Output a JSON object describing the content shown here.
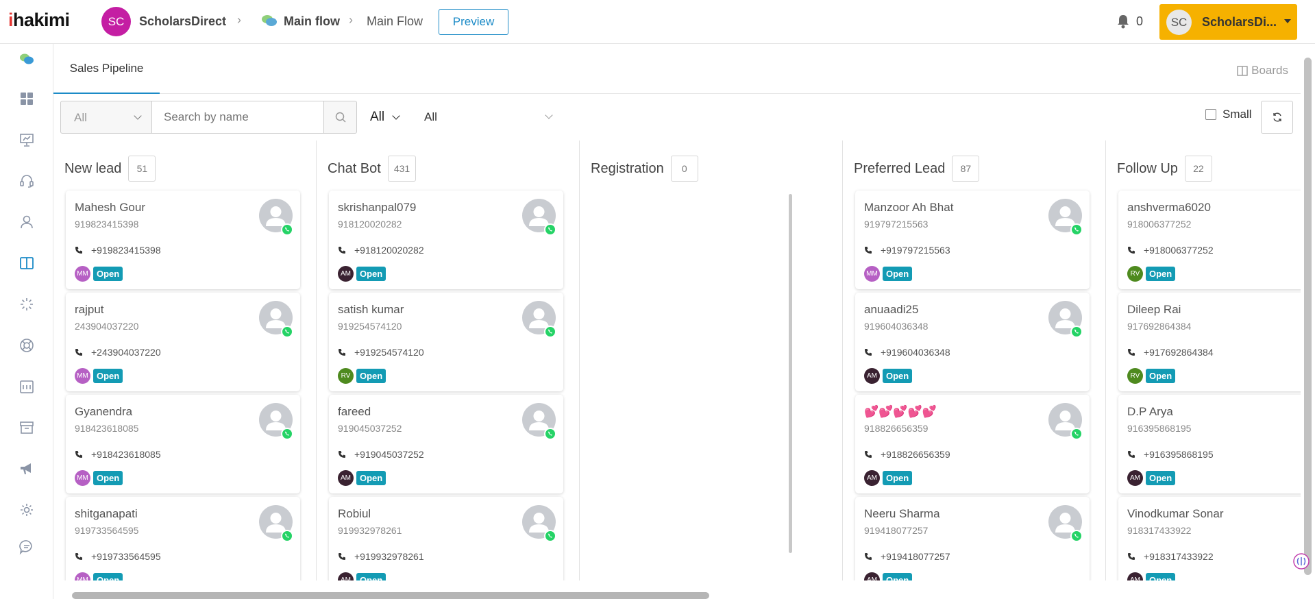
{
  "header": {
    "logo": {
      "dot": "i",
      "rest": "hakimi"
    },
    "workspace": {
      "initials": "SC",
      "name": "ScholarsDirect"
    },
    "breadcrumb": {
      "main": "Main flow",
      "sub": "Main Flow"
    },
    "preview_label": "Preview",
    "notification_count": "0",
    "user": {
      "initials": "SC",
      "name": "ScholarsDi..."
    }
  },
  "tabs": {
    "active": "Sales Pipeline",
    "boards_label": "Boards"
  },
  "filters": {
    "select_all": "All",
    "search_placeholder": "Search by name",
    "dropdown2": "All",
    "dropdown3": "All",
    "small_label": "Small"
  },
  "colors": {
    "accent": "#1c8bc7",
    "user_button": "#f6b100",
    "open_badge": "#139bb4",
    "whatsapp": "#25d366"
  },
  "columns": [
    {
      "title": "New lead",
      "count": "51",
      "cards": [
        {
          "name": "Mahesh Gour",
          "number": "919823415398",
          "phone": "+919823415398",
          "initials": "MM",
          "initials_color": "#b660c4",
          "status": "Open"
        },
        {
          "name": "rajput",
          "number": "243904037220",
          "phone": "+243904037220",
          "initials": "MM",
          "initials_color": "#b660c4",
          "status": "Open"
        },
        {
          "name": "Gyanendra",
          "number": "918423618085",
          "phone": "+918423618085",
          "initials": "MM",
          "initials_color": "#b660c4",
          "status": "Open"
        },
        {
          "name": "shitganapati",
          "number": "919733564595",
          "phone": "+919733564595",
          "initials": "MM",
          "initials_color": "#b660c4",
          "status": "Open"
        }
      ]
    },
    {
      "title": "Chat Bot",
      "count": "431",
      "cards": [
        {
          "name": "skrishanpal079",
          "number": "918120020282",
          "phone": "+918120020282",
          "initials": "AM",
          "initials_color": "#3a2231",
          "status": "Open"
        },
        {
          "name": "satish kumar",
          "number": "919254574120",
          "phone": "+919254574120",
          "initials": "RV",
          "initials_color": "#4e8a1e",
          "status": "Open"
        },
        {
          "name": "fareed",
          "number": "919045037252",
          "phone": "+919045037252",
          "initials": "AM",
          "initials_color": "#3a2231",
          "status": "Open"
        },
        {
          "name": "Robiul",
          "number": "919932978261",
          "phone": "+919932978261",
          "initials": "AM",
          "initials_color": "#3a2231",
          "status": "Open"
        }
      ]
    },
    {
      "title": "Registration",
      "count": "0",
      "cards": []
    },
    {
      "title": "Preferred Lead",
      "count": "87",
      "cards": [
        {
          "name": "Manzoor Ah Bhat",
          "number": "919797215563",
          "phone": "+919797215563",
          "initials": "MM",
          "initials_color": "#b660c4",
          "status": "Open"
        },
        {
          "name": "anuaadi25",
          "number": "919604036348",
          "phone": "+919604036348",
          "initials": "AM",
          "initials_color": "#3a2231",
          "status": "Open"
        },
        {
          "name": "💕💕💕💕💕",
          "number": "918826656359",
          "phone": "+918826656359",
          "initials": "AM",
          "initials_color": "#3a2231",
          "status": "Open"
        },
        {
          "name": "Neeru Sharma",
          "number": "919418077257",
          "phone": "+919418077257",
          "initials": "AM",
          "initials_color": "#3a2231",
          "status": "Open"
        }
      ]
    },
    {
      "title": "Follow Up",
      "count": "22",
      "cards": [
        {
          "name": "anshverma6020",
          "number": "918006377252",
          "phone": "+918006377252",
          "initials": "RV",
          "initials_color": "#4e8a1e",
          "status": "Open"
        },
        {
          "name": "Dileep Rai",
          "number": "917692864384",
          "phone": "+917692864384",
          "initials": "RV",
          "initials_color": "#4e8a1e",
          "status": "Open"
        },
        {
          "name": "D.P Arya",
          "number": "916395868195",
          "phone": "+916395868195",
          "initials": "AM",
          "initials_color": "#3a2231",
          "status": "Open"
        },
        {
          "name": "Vinodkumar Sonar",
          "number": "918317433922",
          "phone": "+918317433922",
          "initials": "AM",
          "initials_color": "#3a2231",
          "status": "Open"
        }
      ]
    }
  ],
  "sidebar": {
    "icons": [
      "chat-bubbles-icon",
      "dashboard-icon",
      "presentation-icon",
      "headset-icon",
      "user-icon",
      "board-icon",
      "loader-icon",
      "lifebuoy-icon",
      "calendar-icon",
      "archive-icon",
      "megaphone-icon",
      "settings-icon",
      "message-icon"
    ]
  }
}
